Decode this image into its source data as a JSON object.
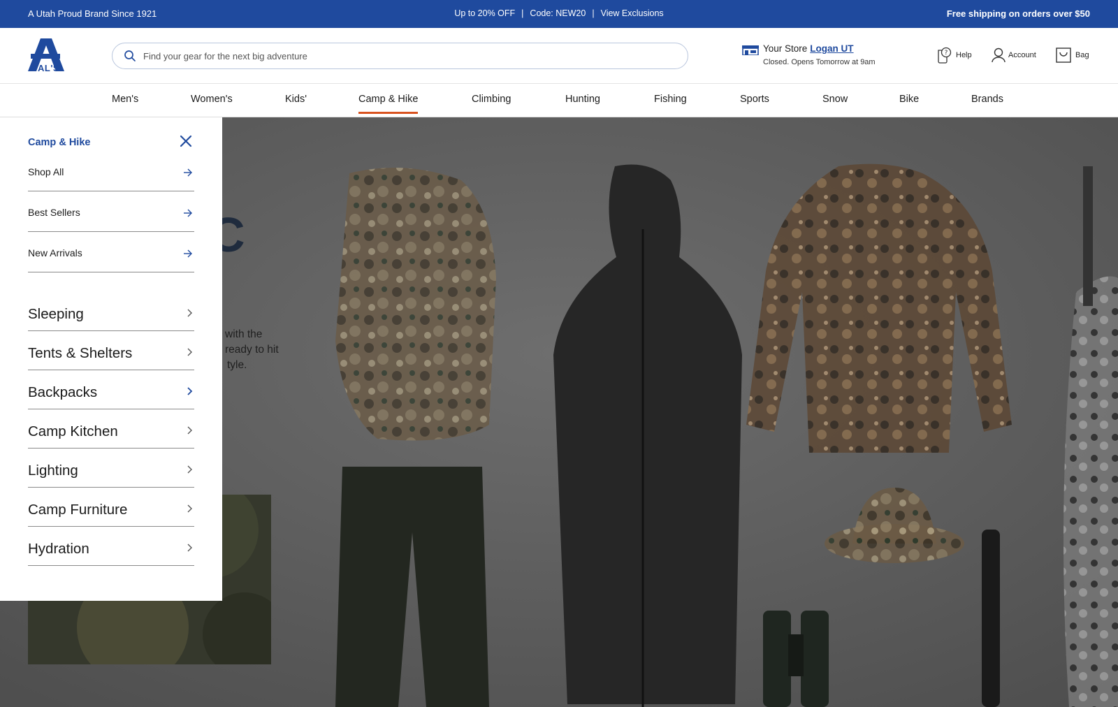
{
  "promo": {
    "left": "A Utah Proud Brand Since 1921",
    "offer": "Up to 20% OFF",
    "code": "Code: NEW20",
    "exclusions": "View Exclusions",
    "right": "Free shipping on orders over $50"
  },
  "header": {
    "logo_text": "AL'S",
    "search_placeholder": "Find your gear for the next big adventure",
    "store_label": "Your Store",
    "store_name": "Logan UT",
    "store_status": "Closed. Opens Tomorrow at 9am",
    "help": "Help",
    "account": "Account",
    "bag": "Bag"
  },
  "nav": {
    "items": [
      "Men's",
      "Women's",
      "Kids'",
      "Camp & Hike",
      "Climbing",
      "Hunting",
      "Fishing",
      "Sports",
      "Snow",
      "Bike",
      "Brands"
    ],
    "active": "Camp & Hike"
  },
  "flyout": {
    "title": "Camp & Hike",
    "quick_links": [
      "Shop All",
      "Best Sellers",
      "New Arrivals"
    ],
    "categories": [
      "Sleeping",
      "Tents & Shelters",
      "Backpacks",
      "Camp Kitchen",
      "Lighting",
      "Camp Furniture",
      "Hydration"
    ]
  },
  "hero": {
    "big_letter": "C",
    "copy_lines": [
      "with the",
      "ready to hit",
      "tyle."
    ]
  },
  "colors": {
    "brand_blue": "#1f4a9e",
    "nav_active_underline": "#d8521f"
  }
}
